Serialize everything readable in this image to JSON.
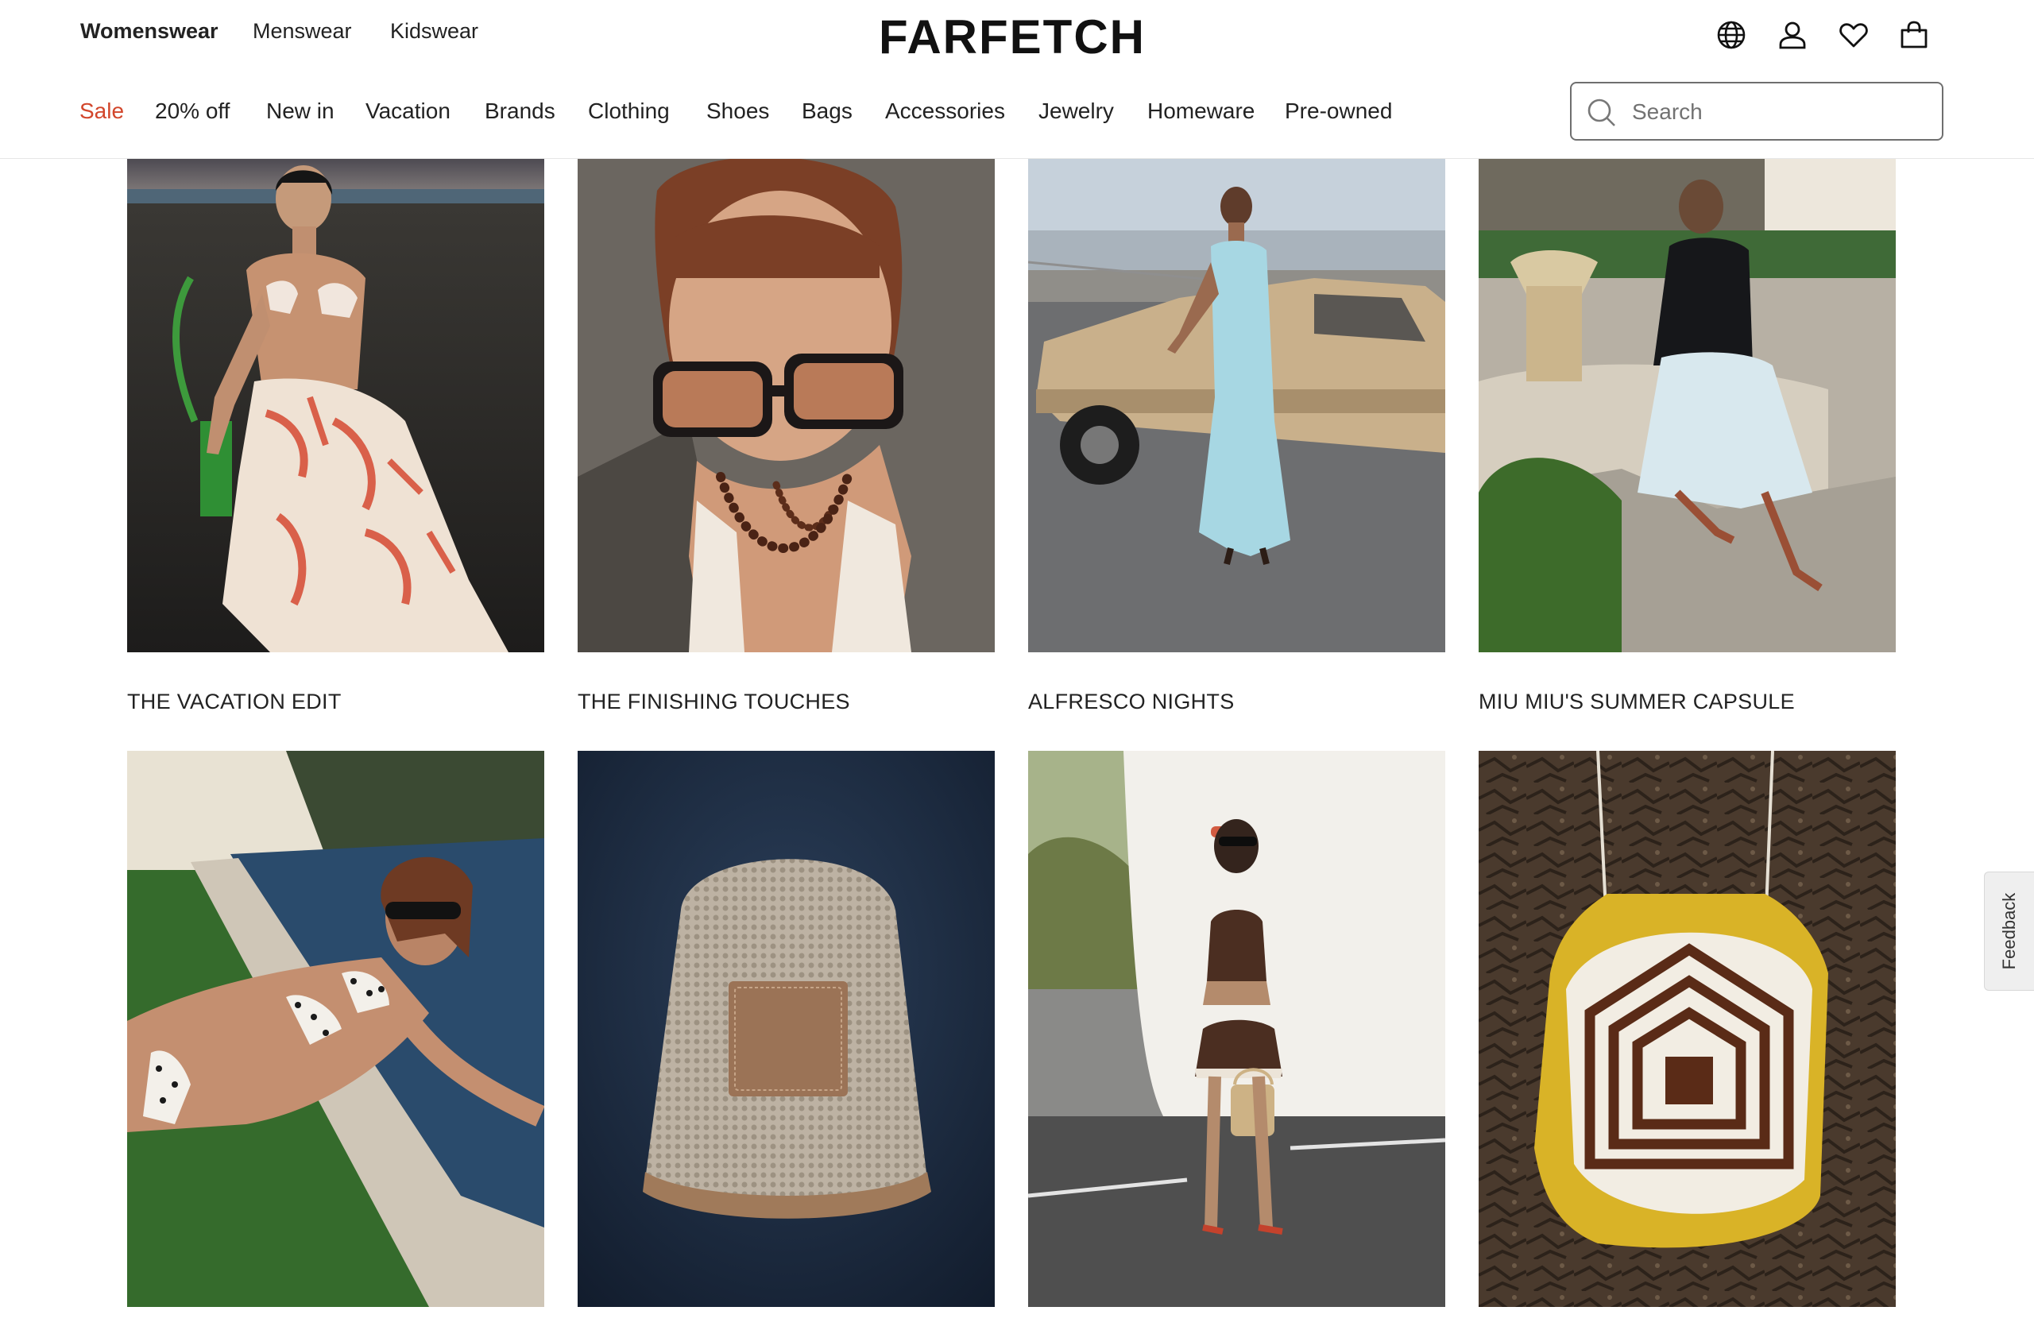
{
  "header": {
    "departments": [
      "Womenswear",
      "Menswear",
      "Kidswear"
    ],
    "active_department": "Womenswear",
    "logo": "FARFETCH",
    "icons": [
      "globe-icon",
      "account-icon",
      "wishlist-heart-icon",
      "shopping-bag-icon"
    ]
  },
  "nav": {
    "items": [
      "Sale",
      "20% off",
      "New in",
      "Vacation",
      "Brands",
      "Clothing",
      "Shoes",
      "Bags",
      "Accessories",
      "Jewelry",
      "Homeware",
      "Pre-owned"
    ],
    "highlight_color": "#d2462b"
  },
  "search": {
    "placeholder": "Search",
    "value": ""
  },
  "editorial": {
    "row1": [
      {
        "title": "THE VACATION EDIT"
      },
      {
        "title": "THE FINISHING TOUCHES"
      },
      {
        "title": "ALFRESCO NIGHTS"
      },
      {
        "title": "MIU MIU'S SUMMER CAPSULE"
      }
    ],
    "row2": [
      {
        "title": ""
      },
      {
        "title": ""
      },
      {
        "title": ""
      },
      {
        "title": ""
      }
    ]
  },
  "feedback": {
    "label": "Feedback"
  }
}
